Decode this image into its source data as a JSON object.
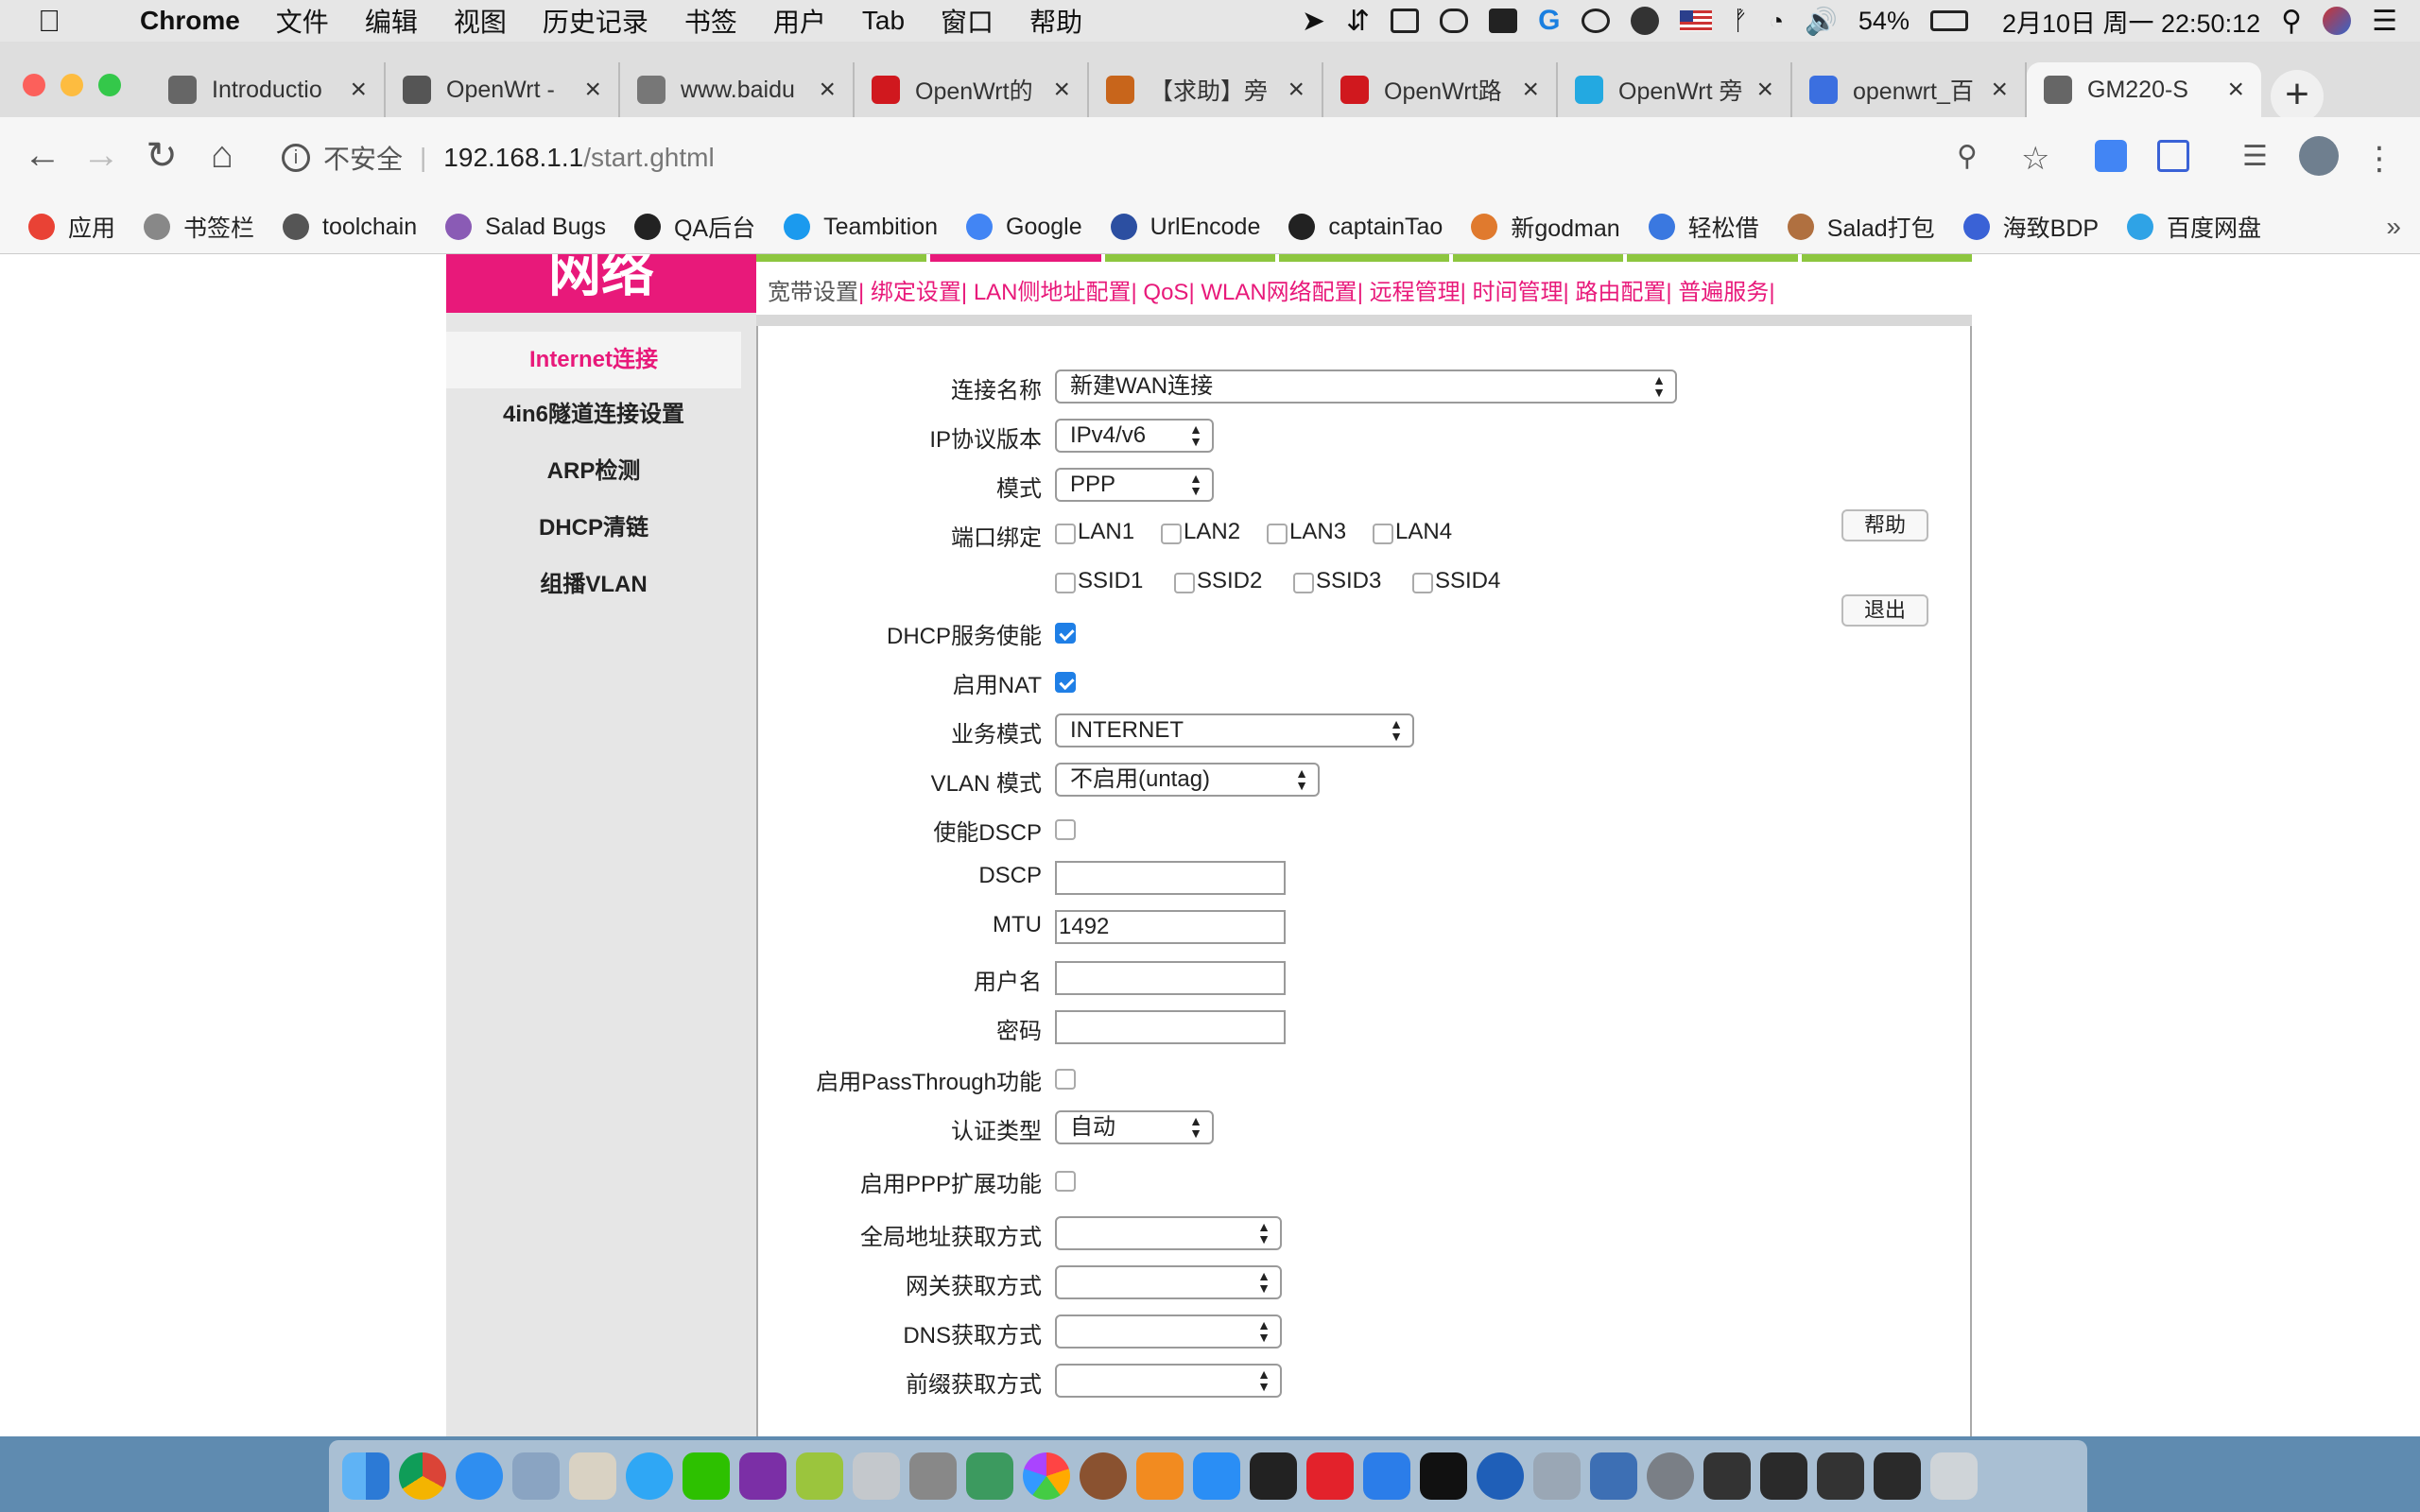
{
  "menubar": {
    "app": "Chrome",
    "items": [
      "文件",
      "编辑",
      "视图",
      "历史记录",
      "书签",
      "用户",
      "Tab",
      "窗口",
      "帮助"
    ],
    "battery": "54%",
    "datetime": "2月10日 周一  22:50:12"
  },
  "tabs": [
    {
      "title": "Introductio",
      "color": "#666666"
    },
    {
      "title": "OpenWrt -",
      "color": "#555555"
    },
    {
      "title": "www.baidu",
      "color": "#777777"
    },
    {
      "title": "OpenWrt的",
      "color": "#d0181e"
    },
    {
      "title": "【求助】旁",
      "color": "#c8651b"
    },
    {
      "title": "OpenWrt路",
      "color": "#d0181e"
    },
    {
      "title": "OpenWrt 旁",
      "color": "#23a9e1"
    },
    {
      "title": "openwrt_百",
      "color": "#3b6fe0"
    },
    {
      "title": "GM220-S",
      "color": "#666666",
      "active": true
    }
  ],
  "address": {
    "security": "不安全",
    "host": "192.168.1.1",
    "path": "/start.ghtml"
  },
  "bookmarks": [
    {
      "label": "应用",
      "color": "#e94235"
    },
    {
      "label": "书签栏",
      "color": "#888888"
    },
    {
      "label": "toolchain",
      "color": "#555555"
    },
    {
      "label": "Salad Bugs",
      "color": "#8a5bb5"
    },
    {
      "label": "QA后台",
      "color": "#222222"
    },
    {
      "label": "Teambition",
      "color": "#1b9aee"
    },
    {
      "label": "Google",
      "color": "#4285f4"
    },
    {
      "label": "UrlEncode",
      "color": "#2c4fa1"
    },
    {
      "label": "captainTao",
      "color": "#222222"
    },
    {
      "label": "新godman",
      "color": "#e07a2e"
    },
    {
      "label": "轻松借",
      "color": "#3a78e0"
    },
    {
      "label": "Salad打包",
      "color": "#b07040"
    },
    {
      "label": "海致BDP",
      "color": "#3a62d6"
    },
    {
      "label": "百度网盘",
      "color": "#2fa3e6"
    }
  ],
  "bookmarks_more": "»",
  "router": {
    "brand": "网络",
    "subnav": {
      "current": "宽带设置",
      "items": [
        "绑定设置",
        "LAN侧地址配置",
        "QoS",
        "WLAN网络配置",
        "远程管理",
        "时间管理",
        "路由配置",
        "普遍服务"
      ]
    },
    "sidebar": [
      "Internet连接",
      "4in6隧道连接设置",
      "ARP检测",
      "DHCP清链",
      "组播VLAN"
    ],
    "form": {
      "connection_name": {
        "label": "连接名称",
        "value": "新建WAN连接"
      },
      "ip_version": {
        "label": "IP协议版本",
        "value": "IPv4/v6"
      },
      "mode": {
        "label": "模式",
        "value": "PPP"
      },
      "port_binding": {
        "label": "端口绑定",
        "ports": [
          "LAN1",
          "LAN2",
          "LAN3",
          "LAN4"
        ],
        "ssids": [
          "SSID1",
          "SSID2",
          "SSID3",
          "SSID4"
        ]
      },
      "dhcp_server": {
        "label": "DHCP服务使能",
        "checked": true
      },
      "nat": {
        "label": "启用NAT",
        "checked": true
      },
      "service_mode": {
        "label": "业务模式",
        "value": "INTERNET"
      },
      "vlan_mode": {
        "label": "VLAN 模式",
        "value": "不启用(untag)"
      },
      "dscp_enable": {
        "label": "使能DSCP",
        "checked": false
      },
      "dscp": {
        "label": "DSCP",
        "value": ""
      },
      "mtu": {
        "label": "MTU",
        "value": "1492"
      },
      "username": {
        "label": "用户名",
        "value": ""
      },
      "password": {
        "label": "密码",
        "value": ""
      },
      "passthrough": {
        "label": "启用PassThrough功能",
        "checked": false
      },
      "auth_type": {
        "label": "认证类型",
        "value": "自动"
      },
      "ppp_ext": {
        "label": "启用PPP扩展功能",
        "checked": false
      },
      "global_addr": {
        "label": "全局地址获取方式",
        "value": ""
      },
      "gateway": {
        "label": "网关获取方式",
        "value": ""
      },
      "dns": {
        "label": "DNS获取方式",
        "value": ""
      },
      "prefix": {
        "label": "前缀获取方式",
        "value": ""
      }
    },
    "buttons": {
      "help": "帮助",
      "exit": "退出"
    }
  }
}
